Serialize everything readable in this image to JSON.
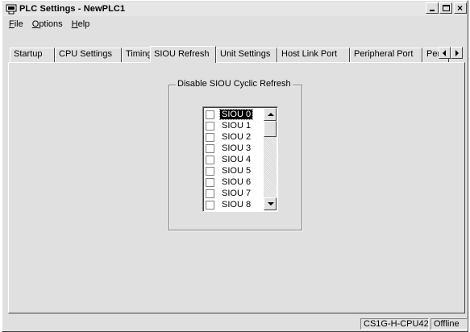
{
  "window": {
    "title": "PLC Settings - NewPLC1",
    "controls": {
      "minimize": "_",
      "maximize": "□",
      "close": "×"
    }
  },
  "menu": {
    "items": [
      {
        "label": "File",
        "hotkey": "F",
        "rest": "ile"
      },
      {
        "label": "Options",
        "hotkey": "O",
        "rest": "ptions"
      },
      {
        "label": "Help",
        "hotkey": "H",
        "rest": "elp"
      }
    ]
  },
  "tabs": {
    "items": [
      {
        "label": "Startup"
      },
      {
        "label": "CPU Settings"
      },
      {
        "label": "Timings"
      },
      {
        "label": "SIOU Refresh",
        "active": true
      },
      {
        "label": "Unit Settings"
      },
      {
        "label": "Host Link Port"
      },
      {
        "label": "Peripheral Port"
      },
      {
        "label": "Peripheral Service"
      }
    ],
    "active_index": 3
  },
  "siou_refresh": {
    "group_label": "Disable SIOU Cyclic Refresh",
    "items": [
      {
        "label": "SIOU 0",
        "checked": false,
        "selected": true
      },
      {
        "label": "SIOU 1",
        "checked": false
      },
      {
        "label": "SIOU 2",
        "checked": false
      },
      {
        "label": "SIOU 3",
        "checked": false
      },
      {
        "label": "SIOU 4",
        "checked": false
      },
      {
        "label": "SIOU 5",
        "checked": false
      },
      {
        "label": "SIOU 6",
        "checked": false
      },
      {
        "label": "SIOU 7",
        "checked": false
      },
      {
        "label": "SIOU 8",
        "checked": false
      }
    ]
  },
  "status": {
    "cpu_model": "CS1G-H-CPU42",
    "connection": "Offline"
  },
  "colors": {
    "face": "#e0e0e0",
    "highlight": "#ffffff",
    "shadow": "#808080",
    "dark_shadow": "#404040",
    "selection": "#000000"
  },
  "icons": {
    "app": "plc-app-icon",
    "scroll_up": "arrow-up-icon",
    "scroll_down": "arrow-down-icon",
    "tab_scroll_left": "arrow-left-icon",
    "tab_scroll_right": "arrow-right-icon"
  }
}
